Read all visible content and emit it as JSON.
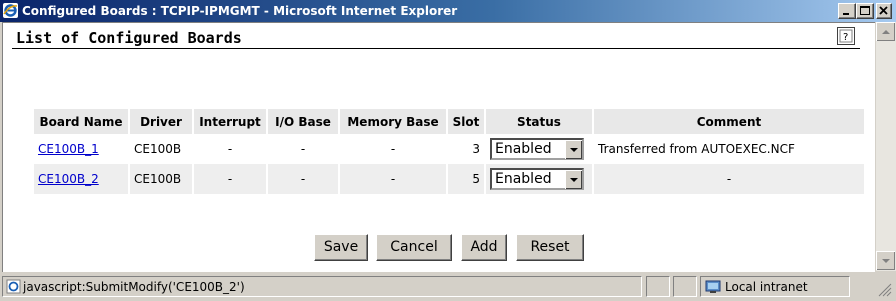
{
  "window": {
    "title": "Configured Boards : TCPIP-IPMGMT - Microsoft Internet Explorer",
    "icon": "ie-icon"
  },
  "page": {
    "title": "List of Configured Boards",
    "help_icon": "help-icon"
  },
  "table": {
    "headers": [
      "Board Name",
      "Driver",
      "Interrupt",
      "I/O Base",
      "Memory Base",
      "Slot",
      "Status",
      "Comment"
    ],
    "rows": [
      {
        "board_name": "CE100B_1",
        "driver": "CE100B",
        "interrupt": "-",
        "io_base": "-",
        "memory_base": "-",
        "slot": "3",
        "status": "Enabled",
        "comment": "Transferred from AUTOEXEC.NCF"
      },
      {
        "board_name": "CE100B_2",
        "driver": "CE100B",
        "interrupt": "-",
        "io_base": "-",
        "memory_base": "-",
        "slot": "5",
        "status": "Enabled",
        "comment": "-"
      }
    ]
  },
  "buttons": {
    "save": "Save",
    "cancel": "Cancel",
    "add": "Add",
    "reset": "Reset"
  },
  "statusbar": {
    "text": "javascript:SubmitModify('CE100B_2')",
    "zone": "Local intranet"
  }
}
